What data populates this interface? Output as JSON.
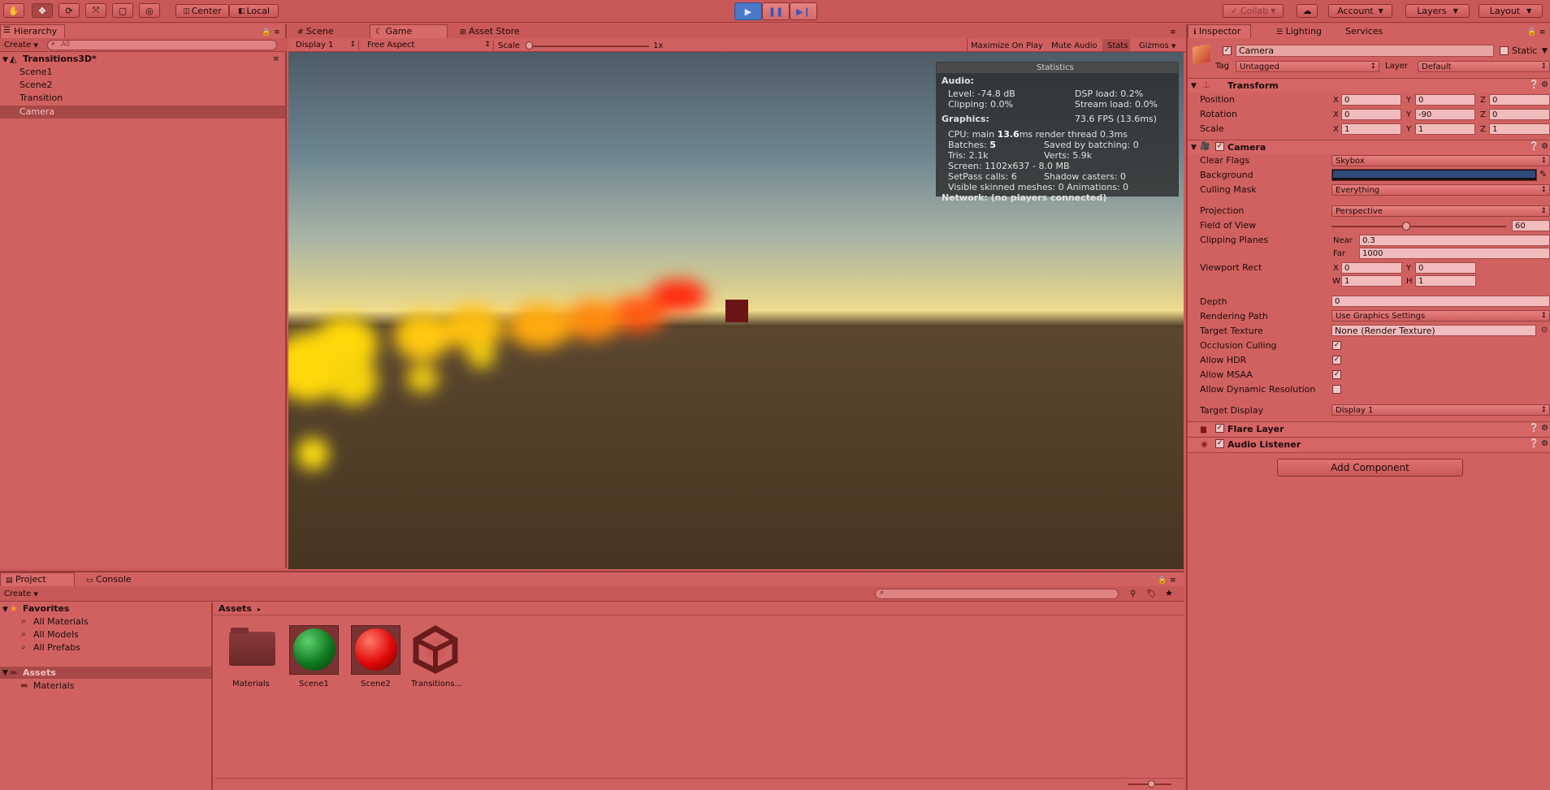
{
  "toolbar": {
    "pivot": "Center",
    "space": "Local",
    "collab": "Collab",
    "account": "Account",
    "layers": "Layers",
    "layout": "Layout"
  },
  "tabs": {
    "hierarchy": "Hierarchy",
    "scene": "Scene",
    "game": "Game",
    "asset_store": "Asset Store",
    "inspector": "Inspector",
    "lighting": "Lighting",
    "services": "Services",
    "project": "Project",
    "console": "Console"
  },
  "hierarchy": {
    "create": "Create",
    "search_placeholder": "All",
    "scene_name": "Transitions3D*",
    "items": [
      "Scene1",
      "Scene2",
      "Transition",
      "Camera"
    ],
    "selected": "Camera"
  },
  "game": {
    "display": "Display 1",
    "aspect": "Free Aspect",
    "scale_label": "Scale",
    "scale_value": "1x",
    "maximize": "Maximize On Play",
    "mute": "Mute Audio",
    "stats": "Stats",
    "gizmos": "Gizmos"
  },
  "stats": {
    "title": "Statistics",
    "audio": "Audio:",
    "level": "Level: -74.8 dB",
    "dsp": "DSP load: 0.2%",
    "clipping": "Clipping: 0.0%",
    "stream": "Stream load: 0.0%",
    "graphics": "Graphics:",
    "fps": "73.6 FPS (13.6ms)",
    "cpu_prefix": "CPU: main ",
    "cpu_main": "13.6",
    "cpu_suffix": "ms  render thread 0.3ms",
    "batches_prefix": "Batches: ",
    "batches": "5",
    "saved": "Saved by batching: 0",
    "tris": "Tris: 2.1k",
    "verts": "Verts: 5.9k",
    "screen": "Screen: 1102x637 - 8.0 MB",
    "setpass": "SetPass calls: 6",
    "shadow": "Shadow casters: 0",
    "skinned": "Visible skinned meshes: 0  Animations: 0",
    "network": "Network: (no players connected)"
  },
  "inspector": {
    "object_name": "Camera",
    "static": "Static",
    "tag_label": "Tag",
    "tag": "Untagged",
    "layer_label": "Layer",
    "layer": "Default",
    "transform": {
      "title": "Transform",
      "position": "Position",
      "rotation": "Rotation",
      "scale": "Scale",
      "x": "X",
      "y": "Y",
      "z": "Z",
      "pos": [
        "0",
        "0",
        "0"
      ],
      "rot": [
        "0",
        "-90",
        "0"
      ],
      "scl": [
        "1",
        "1",
        "1"
      ]
    },
    "camera": {
      "title": "Camera",
      "clear_flags": "Clear Flags",
      "clear_flags_val": "Skybox",
      "background": "Background",
      "background_color": "#2d4a7a",
      "culling_mask": "Culling Mask",
      "culling_mask_val": "Everything",
      "projection": "Projection",
      "projection_val": "Perspective",
      "fov": "Field of View",
      "fov_val": "60",
      "fov_fraction": 0.43,
      "clipping": "Clipping Planes",
      "near_label": "Near",
      "near": "0.3",
      "far_label": "Far",
      "far": "1000",
      "viewport": "Viewport Rect",
      "vx": "0",
      "vy": "0",
      "vw": "1",
      "vh": "1",
      "w": "W",
      "h": "H",
      "depth": "Depth",
      "depth_val": "0",
      "rendering_path": "Rendering Path",
      "rendering_path_val": "Use Graphics Settings",
      "target_texture": "Target Texture",
      "target_texture_val": "None (Render Texture)",
      "occlusion": "Occlusion Culling",
      "hdr": "Allow HDR",
      "msaa": "Allow MSAA",
      "dynres": "Allow Dynamic Resolution",
      "target_display": "Target Display",
      "target_display_val": "Display 1"
    },
    "flare": "Flare Layer",
    "audio_listener": "Audio Listener",
    "add_component": "Add Component"
  },
  "project": {
    "create": "Create",
    "favorites": "Favorites",
    "fav_items": [
      "All Materials",
      "All Models",
      "All Prefabs"
    ],
    "assets": "Assets",
    "tree_items": [
      "Materials"
    ],
    "breadcrumb": "Assets",
    "assets_items": [
      "Materials",
      "Scene1",
      "Scene2",
      "Transitions..."
    ]
  }
}
